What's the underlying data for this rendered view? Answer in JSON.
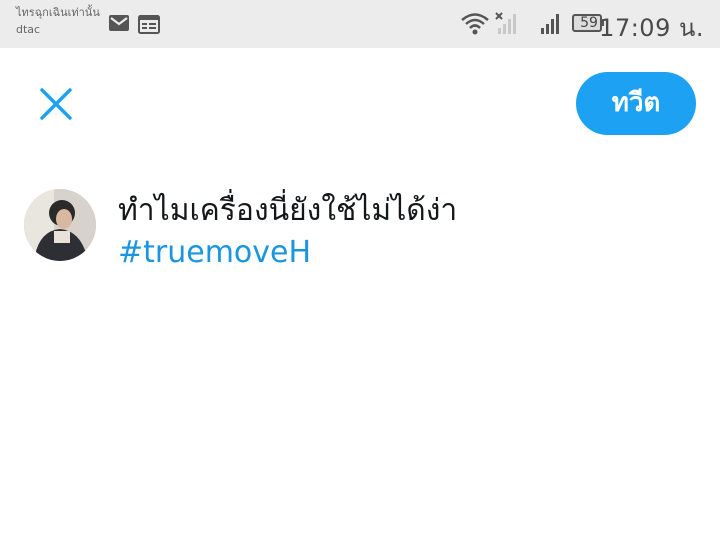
{
  "status_bar": {
    "notification_text": "ไทรฉุกเฉินเท่านั้น",
    "carrier": "dtac",
    "battery_level": "59",
    "time": "17:09 น.",
    "icons": [
      "gmail-icon",
      "calendar-icon",
      "wifi-icon",
      "no-signal-icon",
      "signal-icon",
      "battery-icon"
    ]
  },
  "header": {
    "close_icon": "close-icon",
    "tweet_button_label": "ทวีต",
    "accent_color": "#1da1f2"
  },
  "compose": {
    "text_line": "ทำไมเครื่องนี่ยังใช้ไม่ได้ง่า",
    "hashtag": "#truemoveH",
    "hashtag_color": "#1b95e0"
  }
}
